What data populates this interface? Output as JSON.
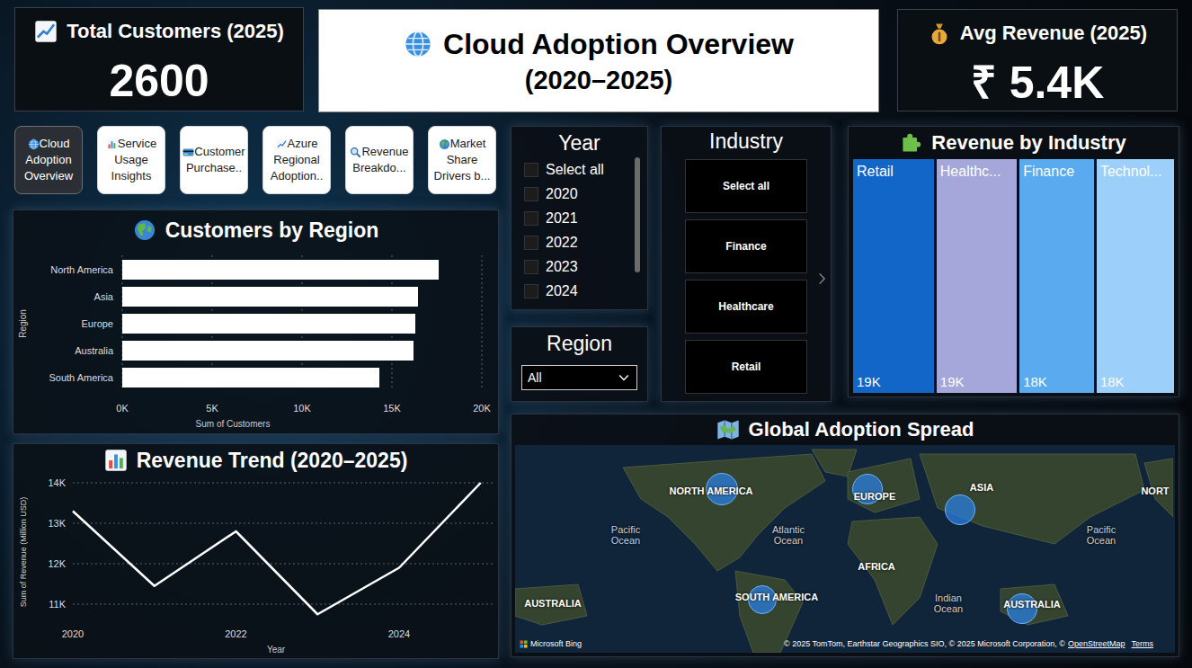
{
  "kpis": [
    {
      "label": "Total Customers (2025)",
      "value": "2600"
    },
    {
      "label": "Avg Revenue (2025)",
      "value": "₹ 5.4K"
    }
  ],
  "title": {
    "line1": "Cloud Adoption Overview",
    "line2": "(2020–2025)"
  },
  "nav": [
    {
      "label": "Cloud Adoption Overview",
      "selected": true
    },
    {
      "label": "Service Usage Insights",
      "selected": false
    },
    {
      "label": "Customer Purchase..",
      "selected": false
    },
    {
      "label": "Azure Regional Adoption..",
      "selected": false
    },
    {
      "label": "Revenue Breakdo...",
      "selected": false
    },
    {
      "label": "Market Share Drivers b...",
      "selected": false
    }
  ],
  "year_slicer": {
    "title": "Year",
    "items": [
      {
        "label": "Select all",
        "selected": false
      },
      {
        "label": "2020",
        "selected": false
      },
      {
        "label": "2021",
        "selected": false
      },
      {
        "label": "2022",
        "selected": false
      },
      {
        "label": "2023",
        "selected": false
      },
      {
        "label": "2024",
        "selected": false
      }
    ]
  },
  "region_slicer": {
    "title": "Region",
    "value": "All"
  },
  "industry_slicer": {
    "title": "Industry",
    "items": [
      {
        "label": "Select all",
        "selected": false
      },
      {
        "label": "Finance",
        "selected": false
      },
      {
        "label": "Healthcare",
        "selected": false
      },
      {
        "label": "Retail",
        "selected": false
      }
    ]
  },
  "revenue_by_industry": {
    "title": "Revenue by Industry",
    "items": [
      {
        "label": "Retail",
        "value_label": "19K",
        "value": 19.3,
        "color": "#1166c8"
      },
      {
        "label": "Healthc...",
        "value_label": "19K",
        "value": 19.2,
        "color": "#a5a6d9"
      },
      {
        "label": "Finance",
        "value_label": "18K",
        "value": 17.8,
        "color": "#5aaaf0"
      },
      {
        "label": "Technol...",
        "value_label": "18K",
        "value": 18.5,
        "color": "#9ccffa"
      }
    ]
  },
  "customers_by_region": {
    "title": "Customers by Region",
    "y_axis_title": "Region",
    "x_axis_title": "Sum of Customers",
    "ticks": [
      "0K",
      "5K",
      "10K",
      "15K",
      "20K"
    ],
    "categories": [
      "North America",
      "Asia",
      "Europe",
      "Australia",
      "South America"
    ],
    "values": [
      17600,
      16450,
      16300,
      16200,
      14300
    ]
  },
  "revenue_trend": {
    "title": "Revenue Trend (2020–2025)",
    "y_axis_title": "Sum of Revenue (Million USD)",
    "x_axis_title": "Year",
    "y_ticks": [
      "14K",
      "13K",
      "12K",
      "11K"
    ],
    "x_ticks": [
      "2020",
      "2022",
      "2024"
    ],
    "values": [
      13300,
      11450,
      12800,
      10750,
      11900,
      14000
    ]
  },
  "map": {
    "title": "Global Adoption Spread",
    "labels": [
      {
        "text": "NORTH AMERICA",
        "kind": "continent"
      },
      {
        "text": "EUROPE",
        "kind": "continent"
      },
      {
        "text": "ASIA",
        "kind": "continent"
      },
      {
        "text": "NORT",
        "kind": "continent"
      },
      {
        "text": "Pacific Ocean",
        "kind": "ocean"
      },
      {
        "text": "Atlantic Ocean",
        "kind": "ocean"
      },
      {
        "text": "AFRICA",
        "kind": "continent"
      },
      {
        "text": "Pacific Ocean",
        "kind": "ocean"
      },
      {
        "text": "SOUTH AMERICA",
        "kind": "continent"
      },
      {
        "text": "Indian Ocean",
        "kind": "ocean"
      },
      {
        "text": "AUSTRALIA",
        "kind": "continent"
      },
      {
        "text": "AUSTRALIA",
        "kind": "continent"
      }
    ],
    "bubble_values": [
      17600,
      16300,
      16450,
      14300,
      16200
    ],
    "logo": "Microsoft Bing",
    "attribution": "© 2025 TomTom, Earthstar Geographics SIO, © 2025 Microsoft Corporation, ©",
    "osm": "OpenStreetMap",
    "terms": "Terms"
  }
}
